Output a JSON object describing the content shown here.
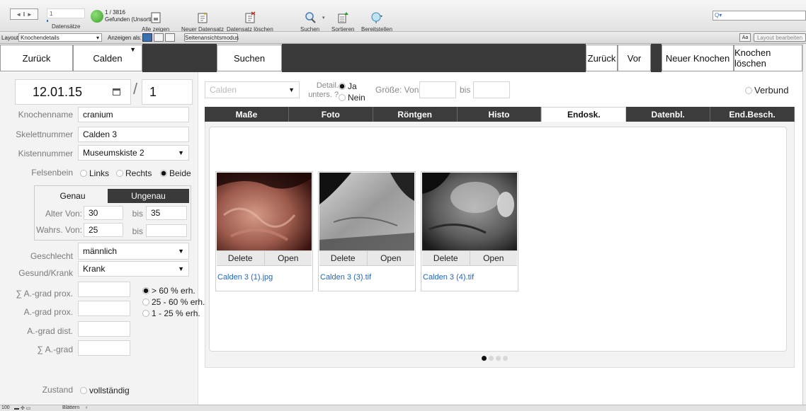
{
  "toolbar": {
    "record_input": "1",
    "records_label": "Datensätze",
    "found_count": "1 / 3816",
    "found_status": "Gefunden (Unsortiert)",
    "show_all": "Alle zeigen",
    "new_record": "Neuer Datensatz",
    "delete_record": "Datensatz löschen",
    "search": "Suchen",
    "sort": "Sortieren",
    "share": "Bereitstellen"
  },
  "layoutbar": {
    "layout_label": "Layout:",
    "layout_value": "Knochendetails",
    "view_as": "Anzeigen als:",
    "preview_mode": "Seitenansichtsmodus",
    "edit_layout": "Layout bearbeiten",
    "font_btn": "Aa"
  },
  "nav": {
    "back1": "Zurück",
    "location": "Calden",
    "search": "Suchen",
    "back2": "Zurück",
    "forward": "Vor",
    "new_bone": "Neuer Knochen",
    "delete_bone": "Knochen löschen"
  },
  "header": {
    "date": "12.01.15",
    "slash": "/",
    "number": "1",
    "site_placeholder": "Calden",
    "detail_label": "Detail. unters. ?",
    "detail_yes": "Ja",
    "detail_no": "Nein",
    "size_from": "Größe: Von",
    "size_to": "bis",
    "verbund": "Verbund"
  },
  "fields": {
    "knochenname_label": "Knochenname",
    "knochenname": "cranium",
    "skelett_label": "Skelettnummer",
    "skelett": "Calden 3",
    "kisten_label": "Kistennummer",
    "kisten": "Museumskiste 2",
    "felsenbein_label": "Felsenbein",
    "felsen_links": "Links",
    "felsen_rechts": "Rechts",
    "felsen_beide": "Beide",
    "genau": "Genau",
    "ungenau": "Ungenau",
    "alter_label": "Alter Von:",
    "alter_von": "30",
    "alter_bis_label": "bis",
    "alter_bis": "35",
    "wahrs_label": "Wahrs. Von:",
    "wahrs_von": "25",
    "wahrs_bis_label": "bis",
    "geschlecht_label": "Geschlecht",
    "geschlecht": "männlich",
    "gesund_label": "Gesund/Krank",
    "gesund": "Krank",
    "sum_prox_label": "∑ A.-grad prox.",
    "prox_label": "A.-grad prox.",
    "dist_label": "A.-grad dist.",
    "sum_label": "∑ A.-grad",
    "erh1": "> 60 % erh.",
    "erh2": "25 - 60 % erh.",
    "erh3": "1 - 25 % erh.",
    "zustand_label": "Zustand",
    "zustand_val": "vollständig"
  },
  "tabs": [
    "Maße",
    "Foto",
    "Röntgen",
    "Histo",
    "Endosk.",
    "Datenbl.",
    "End.Besch."
  ],
  "active_tab": "Endosk.",
  "images": [
    {
      "delete": "Delete",
      "open": "Open",
      "file": "Calden 3 (1).jpg"
    },
    {
      "delete": "Delete",
      "open": "Open",
      "file": "Calden 3 (3).tif"
    },
    {
      "delete": "Delete",
      "open": "Open",
      "file": "Calden 3 (4).tif"
    }
  ],
  "statusbar": {
    "zoom": "100",
    "mode": "Blättern"
  },
  "colors": {
    "dark_bar": "#3a3a3a",
    "link": "#2266bb",
    "record_green": "#3aa02b"
  }
}
